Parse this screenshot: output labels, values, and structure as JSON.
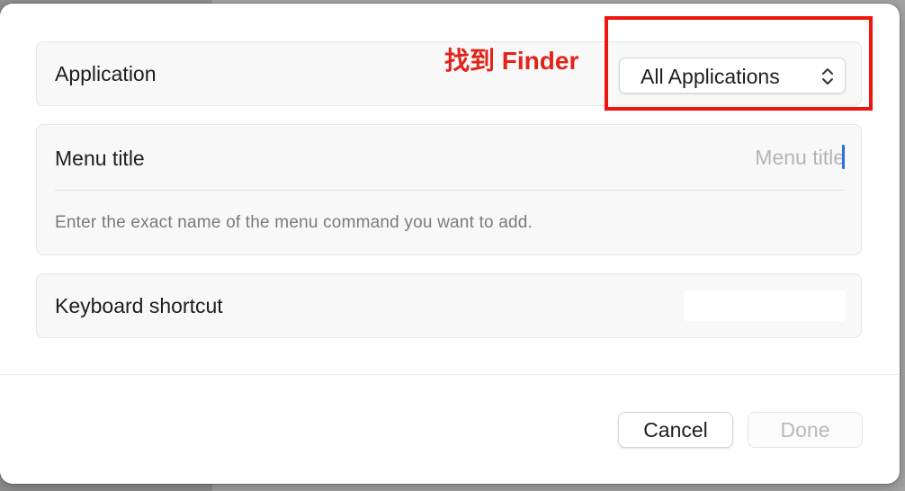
{
  "application": {
    "label": "Application",
    "popup_value": "All Applications"
  },
  "menu_title": {
    "label": "Menu title",
    "placeholder": "Menu title",
    "value": "",
    "help": "Enter the exact name of the menu command you want to add."
  },
  "keyboard_shortcut": {
    "label": "Keyboard shortcut",
    "value": ""
  },
  "footer": {
    "cancel_label": "Cancel",
    "done_label": "Done"
  },
  "annotation": {
    "text": "找到 Finder",
    "color": "#f0140f"
  },
  "colors": {
    "caret": "#2f6fe0",
    "done_disabled_text": "#b9b9b9"
  }
}
